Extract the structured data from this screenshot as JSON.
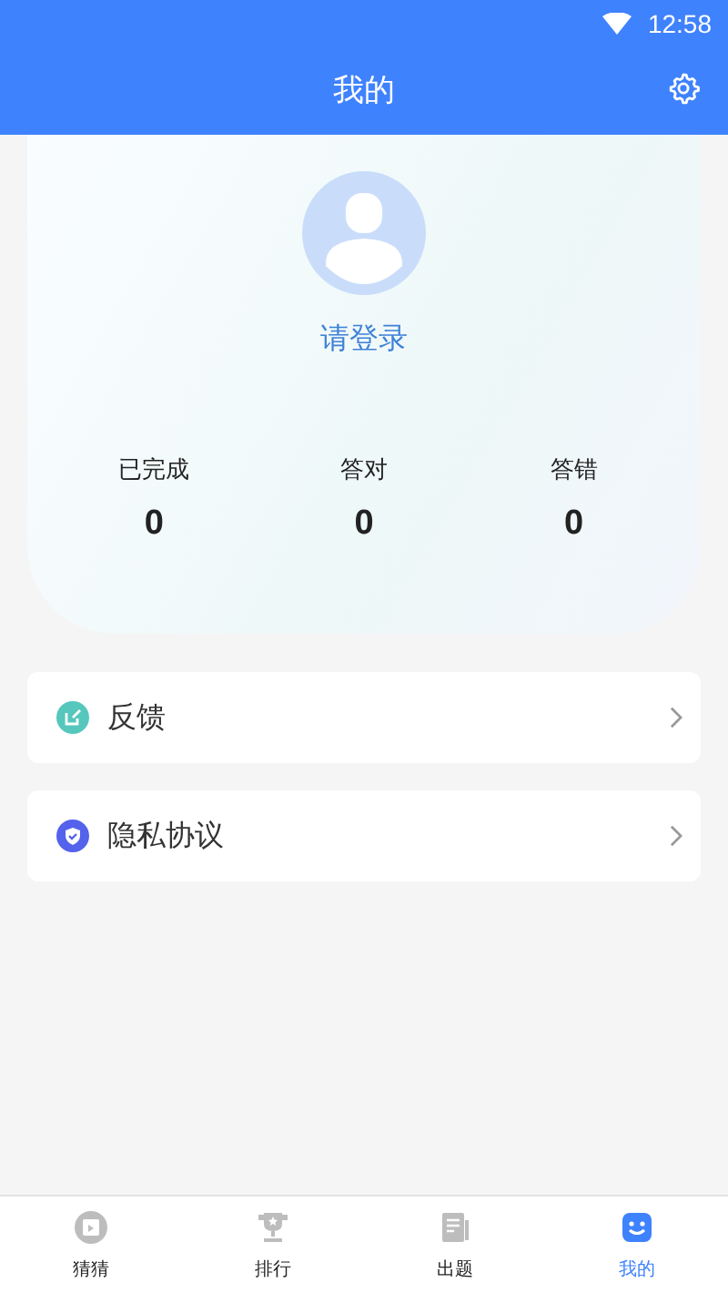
{
  "status_bar": {
    "time": "12:58"
  },
  "header": {
    "title": "我的"
  },
  "profile": {
    "login": "请登录"
  },
  "stats": [
    {
      "label": "已完成",
      "value": "0"
    },
    {
      "label": "答对",
      "value": "0"
    },
    {
      "label": "答错",
      "value": "0"
    }
  ],
  "menu": [
    {
      "label": "反馈",
      "kind": "edit",
      "color": "#56c7bc"
    },
    {
      "label": "隐私协议",
      "kind": "shield",
      "color": "#5462ec"
    }
  ],
  "tabs": [
    {
      "label": "猜猜",
      "kind": "play",
      "selected": false
    },
    {
      "label": "排行",
      "kind": "trophy",
      "selected": false
    },
    {
      "label": "出题",
      "kind": "paper",
      "selected": false
    },
    {
      "label": "我的",
      "kind": "face",
      "selected": true
    }
  ]
}
